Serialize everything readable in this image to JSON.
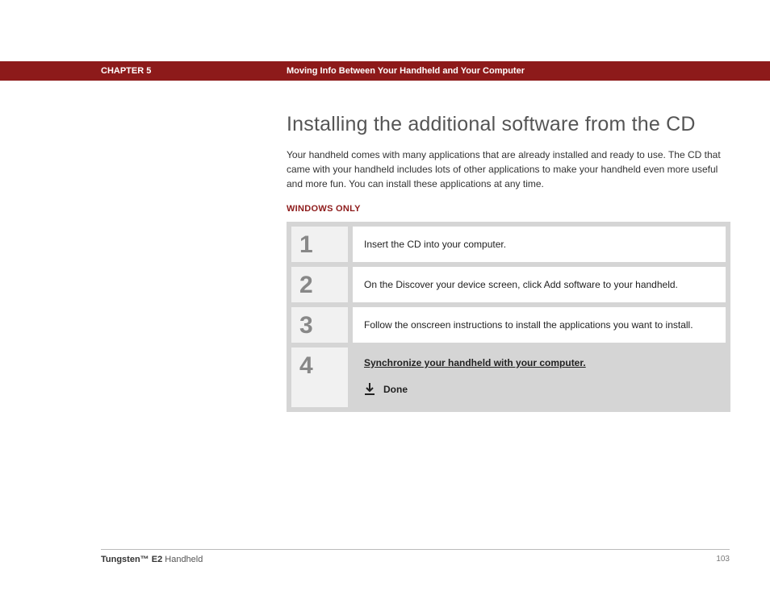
{
  "header": {
    "chapter_label": "CHAPTER 5",
    "chapter_title": "Moving Info Between Your Handheld and Your Computer"
  },
  "main": {
    "heading": "Installing the additional software from the CD",
    "intro": "Your handheld comes with many applications that are already installed and ready to use. The CD that came with your handheld includes lots of other applications to make your handheld even more useful and more fun. You can install these applications at any time.",
    "platform_label": "WINDOWS ONLY",
    "steps": [
      {
        "num": "1",
        "text": "Insert the CD into your computer."
      },
      {
        "num": "2",
        "text": "On the Discover your device screen, click Add software to your handheld."
      },
      {
        "num": "3",
        "text": "Follow the onscreen instructions to install the applications you want to install."
      },
      {
        "num": "4",
        "link": "Synchronize your handheld with your computer.",
        "done": "Done"
      }
    ]
  },
  "footer": {
    "product_bold": "Tungsten™ E2",
    "product_rest": " Handheld",
    "page": "103"
  }
}
